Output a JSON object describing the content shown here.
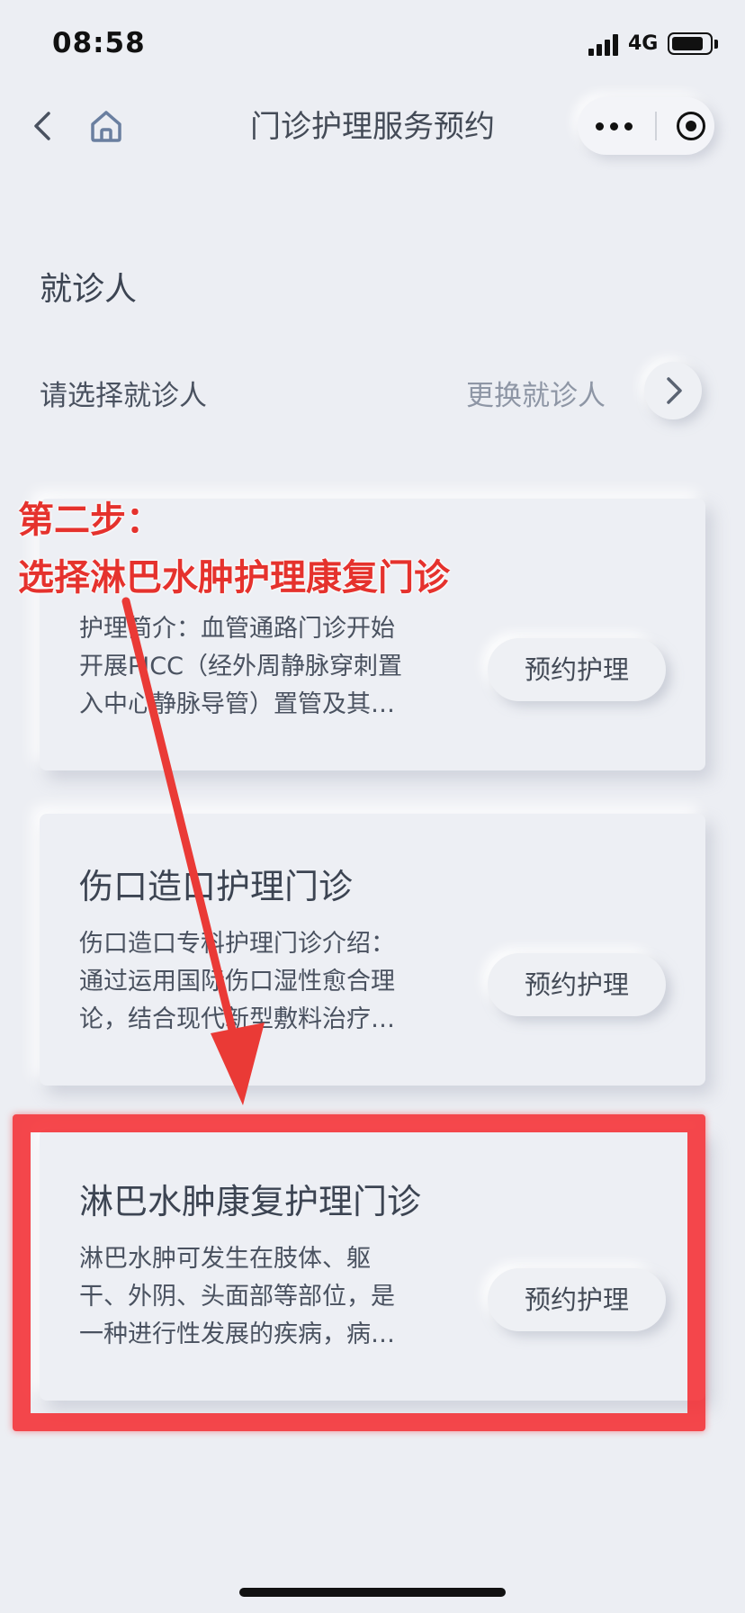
{
  "status_bar": {
    "time": "08:58",
    "network": "4G"
  },
  "nav": {
    "title": "门诊护理服务预约",
    "back_icon": "chevron-left-icon",
    "home_icon": "home-icon",
    "more_icon": "more-dots-icon",
    "close_icon": "target-circle-icon"
  },
  "patient": {
    "section_title": "就诊人",
    "select_label": "请选择就诊人",
    "change_label": "更换就诊人"
  },
  "cards": [
    {
      "title": "",
      "desc_lines": [
        "护理简介：血管通路门诊开始",
        "开展PICC（经外周静脉穿刺置",
        "入中心静脉导管）置管及其…"
      ],
      "button": "预约护理"
    },
    {
      "title": "伤口造口护理门诊",
      "desc_lines": [
        "伤口造口专科护理门诊介绍：",
        "通过运用国际伤口湿性愈合理",
        "论，结合现代新型敷料治疗…"
      ],
      "button": "预约护理"
    },
    {
      "title": "淋巴水肿康复护理门诊",
      "desc_lines": [
        "淋巴水肿可发生在肢体、躯",
        "干、外阴、头面部等部位，是",
        "一种进行性发展的疾病，病…"
      ],
      "button": "预约护理"
    }
  ],
  "annotation": {
    "line1": "第二步：",
    "line2": "选择淋巴水肿护理康复门诊",
    "color": "#e5322d"
  },
  "colors": {
    "background": "#eceef3",
    "accent_red": "#f5282d",
    "text": "#3c4452"
  }
}
